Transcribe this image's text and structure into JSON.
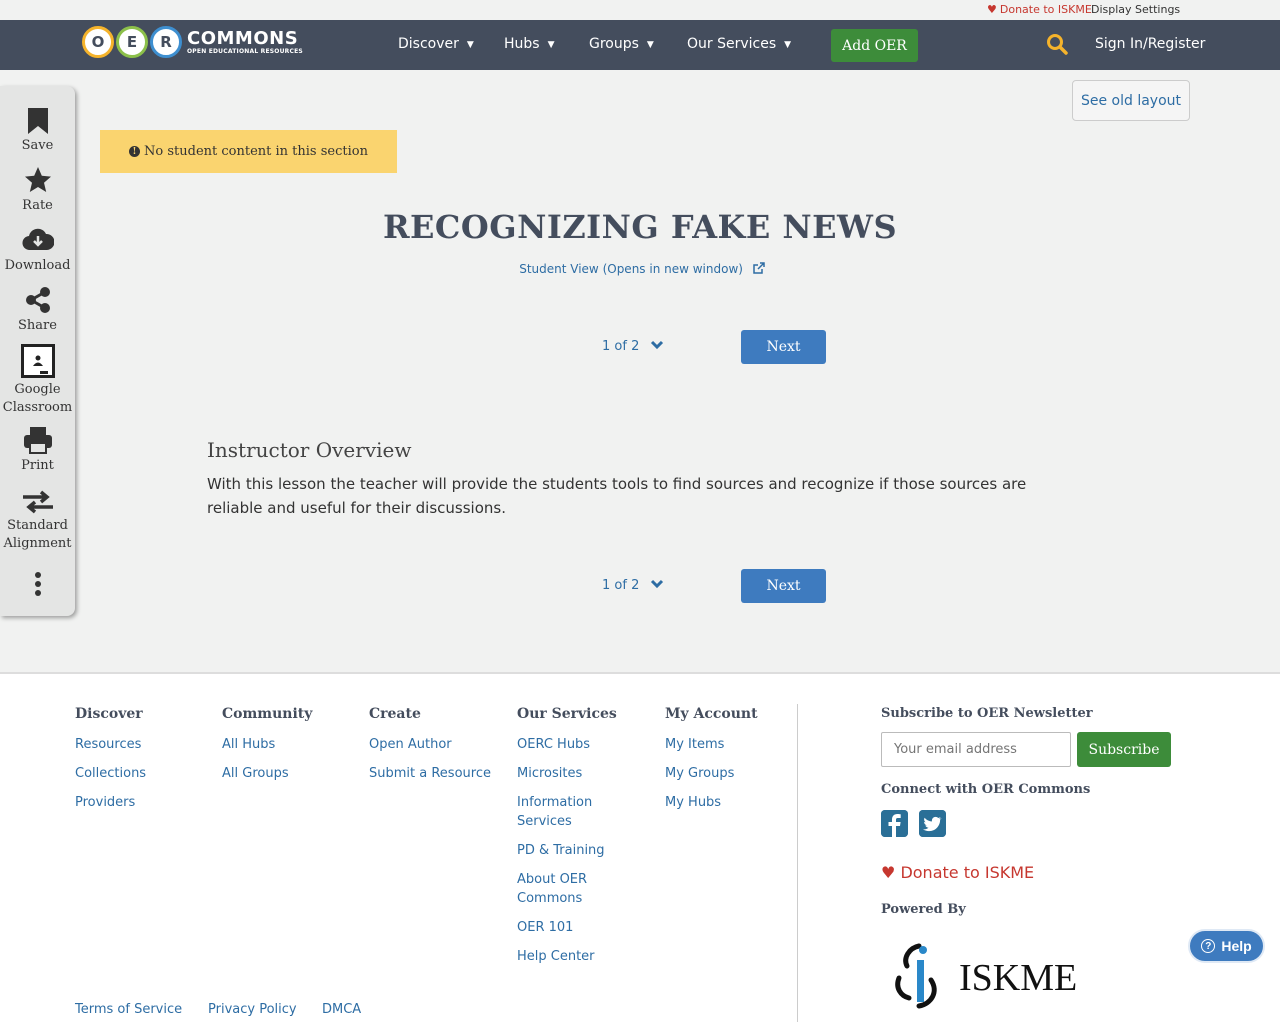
{
  "util_bar": {
    "donate": "Donate to ISKME",
    "display_settings": "Display Settings"
  },
  "header": {
    "logo_letters": [
      "O",
      "E",
      "R"
    ],
    "logo_word": "COMMONS",
    "logo_tagline": "OPEN EDUCATIONAL RESOURCES",
    "nav": [
      "Discover",
      "Hubs",
      "Groups",
      "Our Services"
    ],
    "add_oer": "Add OER",
    "sign_in": "Sign In/Register"
  },
  "side_tools": [
    {
      "label": "Save",
      "icon": "bookmark-icon"
    },
    {
      "label": "Rate",
      "icon": "star-icon"
    },
    {
      "label": "Download",
      "icon": "cloud-download-icon"
    },
    {
      "label": "Share",
      "icon": "share-icon"
    },
    {
      "label": "Google Classroom",
      "icon": "google-classroom-icon"
    },
    {
      "label": "Print",
      "icon": "print-icon"
    },
    {
      "label": "Standard Alignment",
      "icon": "exchange-icon"
    },
    {
      "label": "",
      "icon": "more-vertical-icon"
    }
  ],
  "content": {
    "old_layout": "See old layout",
    "no_student": "No student content in this section",
    "title": "RECOGNIZING FAKE NEWS",
    "student_view": "Student View (Opens in new window)",
    "pager_count": "1 of 2",
    "next": "Next",
    "section_title": "Instructor Overview",
    "section_body": "With this lesson the teacher will provide the students tools to find sources and recognize if those sources are reliable and useful for their discussions."
  },
  "footer": {
    "columns": [
      {
        "heading": "Discover",
        "links": [
          "Resources",
          "Collections",
          "Providers"
        ]
      },
      {
        "heading": "Community",
        "links": [
          "All Hubs",
          "All Groups"
        ]
      },
      {
        "heading": "Create",
        "links": [
          "Open Author",
          "Submit a Resource"
        ]
      },
      {
        "heading": "Our Services",
        "links": [
          "OERC Hubs",
          "Microsites",
          "Information Services",
          "PD & Training",
          "About OER Commons",
          "OER 101",
          "Help Center"
        ]
      },
      {
        "heading": "My Account",
        "links": [
          "My Items",
          "My Groups",
          "My Hubs"
        ]
      }
    ],
    "newsletter_heading": "Subscribe to OER Newsletter",
    "email_placeholder": "Your email address",
    "subscribe": "Subscribe",
    "connect_heading": "Connect with OER Commons",
    "donate": "Donate to ISKME",
    "powered_by": "Powered By",
    "iskme_logo": "ISKME",
    "bottom_links": [
      "Terms of Service",
      "Privacy Policy",
      "DMCA"
    ]
  },
  "help": "Help",
  "colors": {
    "navbar": "#444d5d",
    "accent_green": "#3d8c3a",
    "link_blue": "#2e6da4",
    "banner_yellow": "#fad46f"
  }
}
